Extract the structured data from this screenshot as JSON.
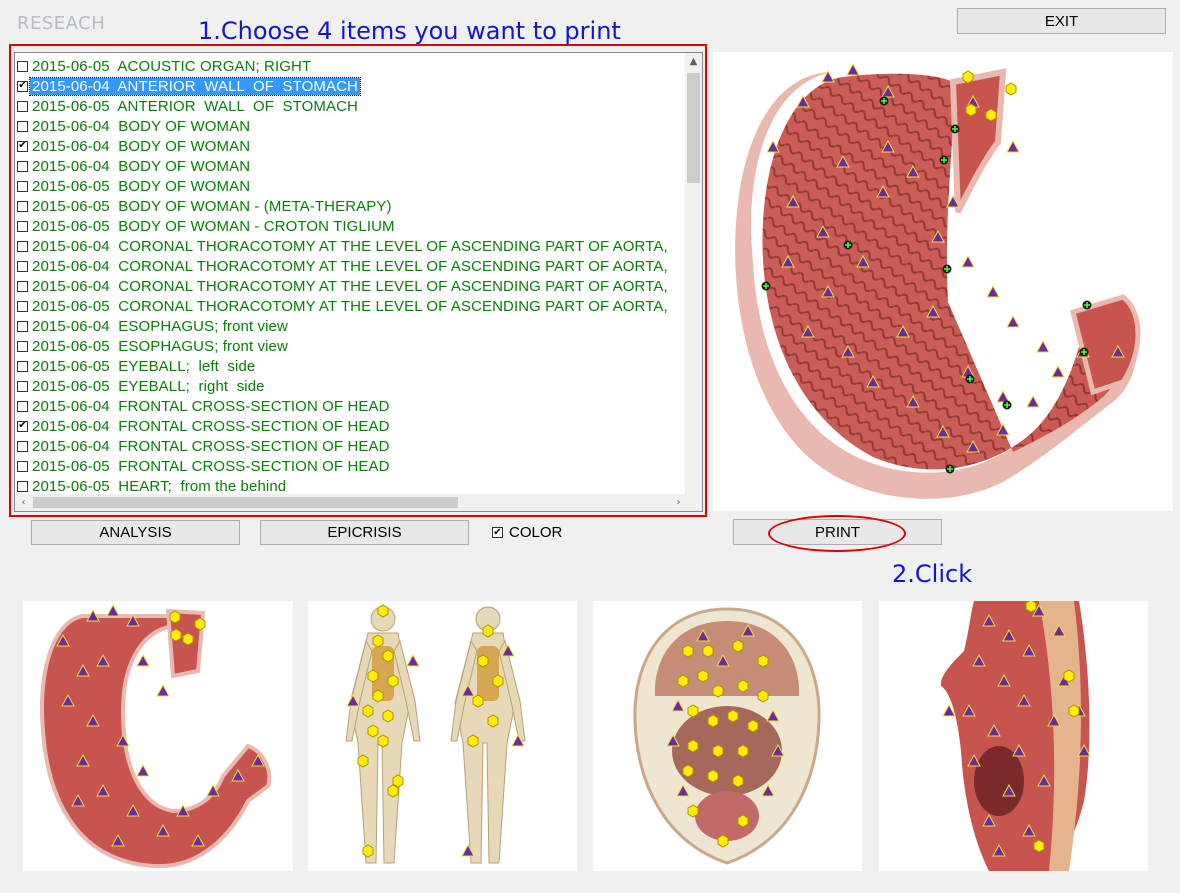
{
  "header": {
    "title": "RESEACH"
  },
  "instructions": {
    "step1": "1.Choose 4 items you want to print",
    "step2": "2.Click"
  },
  "buttons": {
    "exit": "EXIT",
    "analysis": "ANALYSIS",
    "epicrisis": "EPICRISIS",
    "print": "PRINT"
  },
  "color_option": {
    "label": "COLOR",
    "checked": true
  },
  "list": {
    "items": [
      {
        "date": "2015-06-05",
        "name": "ACOUSTIC ORGAN; RIGHT",
        "checked": false,
        "selected": false
      },
      {
        "date": "2015-06-04",
        "name": "ANTERIOR  WALL  OF  STOMACH",
        "checked": true,
        "selected": true
      },
      {
        "date": "2015-06-05",
        "name": "ANTERIOR  WALL  OF  STOMACH",
        "checked": false,
        "selected": false
      },
      {
        "date": "2015-06-04",
        "name": "BODY OF WOMAN",
        "checked": false,
        "selected": false
      },
      {
        "date": "2015-06-04",
        "name": "BODY OF WOMAN",
        "checked": true,
        "selected": false
      },
      {
        "date": "2015-06-04",
        "name": "BODY OF WOMAN",
        "checked": false,
        "selected": false
      },
      {
        "date": "2015-06-05",
        "name": "BODY OF WOMAN",
        "checked": false,
        "selected": false
      },
      {
        "date": "2015-06-05",
        "name": "BODY OF WOMAN - (META-THERAPY)",
        "checked": false,
        "selected": false
      },
      {
        "date": "2015-06-05",
        "name": "BODY OF WOMAN - CROTON TIGLIUM",
        "checked": false,
        "selected": false
      },
      {
        "date": "2015-06-04",
        "name": "CORONAL THORACOTOMY AT THE LEVEL OF ASCENDING PART OF AORTA,",
        "checked": false,
        "selected": false
      },
      {
        "date": "2015-06-04",
        "name": "CORONAL THORACOTOMY AT THE LEVEL OF ASCENDING PART OF AORTA,",
        "checked": false,
        "selected": false
      },
      {
        "date": "2015-06-04",
        "name": "CORONAL THORACOTOMY AT THE LEVEL OF ASCENDING PART OF AORTA,",
        "checked": false,
        "selected": false
      },
      {
        "date": "2015-06-05",
        "name": "CORONAL THORACOTOMY AT THE LEVEL OF ASCENDING PART OF AORTA,",
        "checked": false,
        "selected": false
      },
      {
        "date": "2015-06-04",
        "name": "ESOPHAGUS; front view",
        "checked": false,
        "selected": false
      },
      {
        "date": "2015-06-05",
        "name": "ESOPHAGUS; front view",
        "checked": false,
        "selected": false
      },
      {
        "date": "2015-06-05",
        "name": "EYEBALL;  left  side",
        "checked": false,
        "selected": false
      },
      {
        "date": "2015-06-05",
        "name": "EYEBALL;  right  side",
        "checked": false,
        "selected": false
      },
      {
        "date": "2015-06-04",
        "name": "FRONTAL CROSS-SECTION OF HEAD",
        "checked": false,
        "selected": false
      },
      {
        "date": "2015-06-04",
        "name": "FRONTAL CROSS-SECTION OF HEAD",
        "checked": true,
        "selected": false
      },
      {
        "date": "2015-06-04",
        "name": "FRONTAL CROSS-SECTION OF HEAD",
        "checked": false,
        "selected": false
      },
      {
        "date": "2015-06-05",
        "name": "FRONTAL CROSS-SECTION OF HEAD",
        "checked": false,
        "selected": false
      },
      {
        "date": "2015-06-05",
        "name": "HEART;  from the behind",
        "checked": false,
        "selected": false
      }
    ]
  },
  "colors": {
    "accent_red": "#e00000",
    "instruction_blue": "#1414d2",
    "list_text_green": "#0a7d0a",
    "selection_blue": "#3399ff",
    "tissue": "#c8544f",
    "marker_yellow": "#ffee00",
    "marker_triangle": "#6a2c9a"
  },
  "images": {
    "main": "stomach-image",
    "thumbnails": [
      "stomach-thumbnail",
      "body-of-woman-thumbnail",
      "head-cross-section-thumbnail",
      "coronal-thoracotomy-thumbnail"
    ]
  }
}
